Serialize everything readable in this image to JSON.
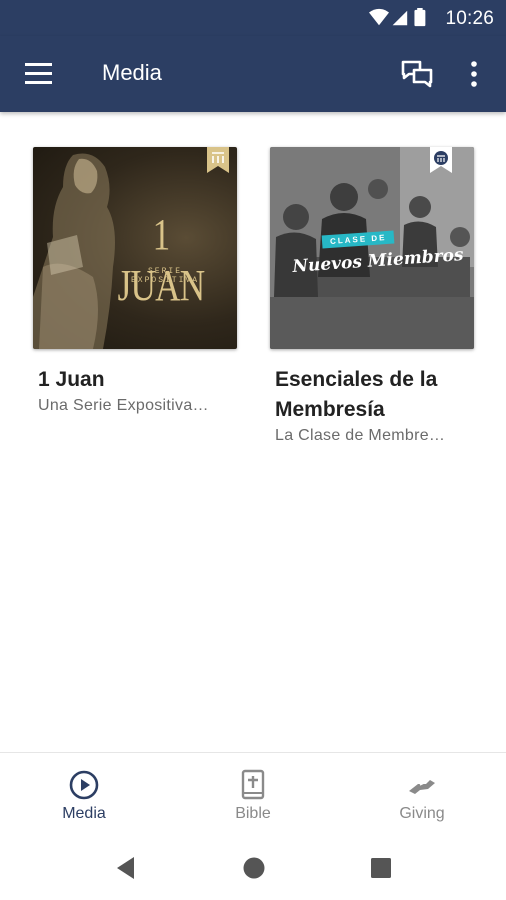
{
  "status_bar": {
    "time": "10:26",
    "icons": [
      "wifi-icon",
      "signal-icon",
      "battery-icon"
    ]
  },
  "app_bar": {
    "title": "Media",
    "menu_icon": "hamburger-menu-icon",
    "chat_icon": "chat-icon",
    "more_icon": "more-vertical-icon",
    "color": "#2c3e63"
  },
  "media_items": [
    {
      "title": "1 Juan",
      "subtitle": "Una Serie Expositiva…",
      "artwork_title": "1 JUAN",
      "artwork_subtitle": "SERIE EXPOSITIVA"
    },
    {
      "title": "Esenciales de la Membresía",
      "subtitle": "La Clase de Membre…",
      "artwork_banner": "CLASE DE",
      "artwork_script": "Nuevos Miembros"
    }
  ],
  "bottom_nav": {
    "items": [
      {
        "label": "Media",
        "icon": "play-circle-icon",
        "active": true
      },
      {
        "label": "Bible",
        "icon": "bible-icon",
        "active": false
      },
      {
        "label": "Giving",
        "icon": "giving-hand-icon",
        "active": false
      }
    ]
  },
  "system_nav": [
    "back-icon",
    "home-icon",
    "recents-icon"
  ],
  "colors": {
    "primary": "#2c3e63",
    "inactive": "#8a8a8a",
    "artwork_gold": "#d9c389",
    "artwork_teal": "#27b8c6"
  }
}
